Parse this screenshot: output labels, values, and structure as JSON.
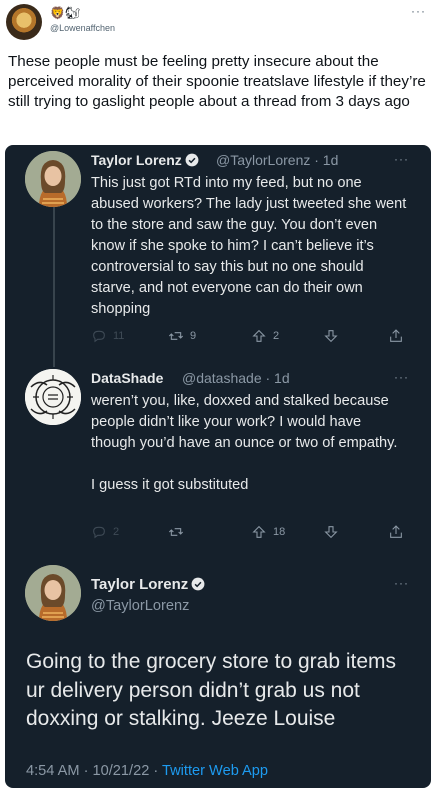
{
  "outer": {
    "emoji": "🦁🐿",
    "handle": "@Lowenaffchen",
    "text": "These people must be feeling pretty insecure about the perceived morality of their spoonie treatslave lifestyle if they’re still trying to gaslight people about a thread from 3 days ago"
  },
  "card": {
    "tweet1": {
      "name": "Taylor Lorenz",
      "handle": "@TaylorLorenz · 1d",
      "text": "This just got RTd into my feed, but no one abused workers? The lady just tweeted she went to the store and saw the guy. You don’t even know if she spoke to him? I can’t believe it’s controversial to say this but no one should starve, and not everyone can do their own shopping",
      "replies": "11",
      "retweets": "9",
      "likes": "2"
    },
    "tweet2": {
      "name": "DataShade",
      "handle": "@datashade · 1d",
      "text": "weren’t you, like, doxxed and stalked because people didn’t like your work? I would have though you’d have an ounce or two of empathy.",
      "text2": "I guess it got substituted",
      "replies": "2",
      "likes": "18"
    },
    "main": {
      "name": "Taylor Lorenz",
      "handle": "@TaylorLorenz",
      "text": "Going to the grocery store to grab items ur delivery person didn’t grab us not doxxing or stalking. Jeeze Louise",
      "time": "4:54 AM · 10/21/22 · ",
      "app": "Twitter Web App"
    }
  },
  "colors": {
    "card_bg": "#15202b",
    "text_primary": "#e7e9ea",
    "text_secondary": "#8b98a5",
    "verified_blue": "#1d9bf0",
    "link_blue": "#1d9bf0"
  },
  "icons": [
    "reply-icon",
    "retweet-icon",
    "like-icon",
    "download-icon",
    "share-icon",
    "verified-icon",
    "more-icon"
  ]
}
